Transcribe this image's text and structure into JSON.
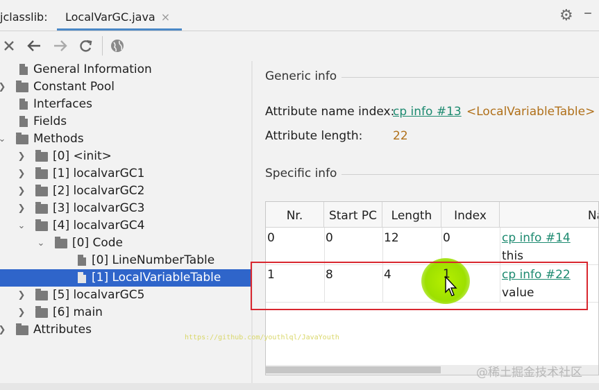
{
  "tabs": [
    {
      "label": "jclasslib:"
    },
    {
      "label": "LocalVarGC.java",
      "close": "×"
    }
  ],
  "tree": {
    "items": [
      {
        "label": "General Information"
      },
      {
        "label": "Constant Pool"
      },
      {
        "label": "Interfaces"
      },
      {
        "label": "Fields"
      },
      {
        "label": "Methods"
      },
      {
        "label": "[0] <init>"
      },
      {
        "label": "[1] localvarGC1"
      },
      {
        "label": "[2] localvarGC2"
      },
      {
        "label": "[3] localvarGC3"
      },
      {
        "label": "[4] localvarGC4"
      },
      {
        "label": "[0] Code"
      },
      {
        "label": "[0] LineNumberTable"
      },
      {
        "label": "[1] LocalVariableTable"
      },
      {
        "label": "[5] localvarGC5"
      },
      {
        "label": "[6] main"
      },
      {
        "label": "Attributes"
      }
    ]
  },
  "detail": {
    "generic_title": "Generic info",
    "attr_name_label": "Attribute name index:",
    "attr_name_link": "cp info #13",
    "attr_name_value": "<LocalVariableTable>",
    "attr_len_label": "Attribute length:",
    "attr_len_value": "22",
    "specific_title": "Specific info"
  },
  "table": {
    "headers": [
      "Nr.",
      "Start PC",
      "Length",
      "Index",
      "Na"
    ],
    "rows": [
      {
        "nr": "0",
        "start": "0",
        "length": "12",
        "index": "0",
        "name_link": "cp info #14",
        "name_value": "this"
      },
      {
        "nr": "1",
        "start": "8",
        "length": "4",
        "index": "1",
        "name_link": "cp info #22",
        "name_value": "value"
      }
    ]
  },
  "watermarks": {
    "url": "https://github.com/youthlql/JavaYouth",
    "site": "@稀土掘金技术社区"
  },
  "colors": {
    "selection": "#2f65ca",
    "link": "#1d8a70",
    "highlight_box": "#d8262e",
    "accent_tab": "#4a88c7"
  }
}
